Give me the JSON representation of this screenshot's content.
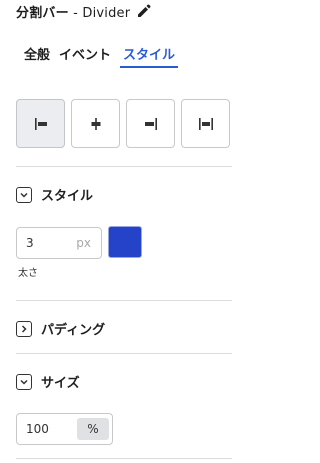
{
  "header": {
    "title": "分割バー",
    "title_suffix": " - Divider",
    "edit_icon": "pencil-icon"
  },
  "tabs": [
    {
      "label": "全般",
      "active": false
    },
    {
      "label": "イベント",
      "active": false
    },
    {
      "label": "スタイル",
      "active": true
    }
  ],
  "alignment": {
    "options": [
      "align-left",
      "align-center",
      "align-right",
      "align-justify"
    ],
    "selected": "align-left"
  },
  "style_section": {
    "label": "スタイル",
    "expanded": true,
    "thickness": {
      "value": "3",
      "unit": "px",
      "caption": "太さ"
    },
    "color": "#2443c8"
  },
  "padding_section": {
    "label": "パディング",
    "expanded": false
  },
  "size_section": {
    "label": "サイズ",
    "expanded": true,
    "width": {
      "value": "100",
      "unit": "%"
    }
  },
  "accent_color": "#2a5bd7"
}
